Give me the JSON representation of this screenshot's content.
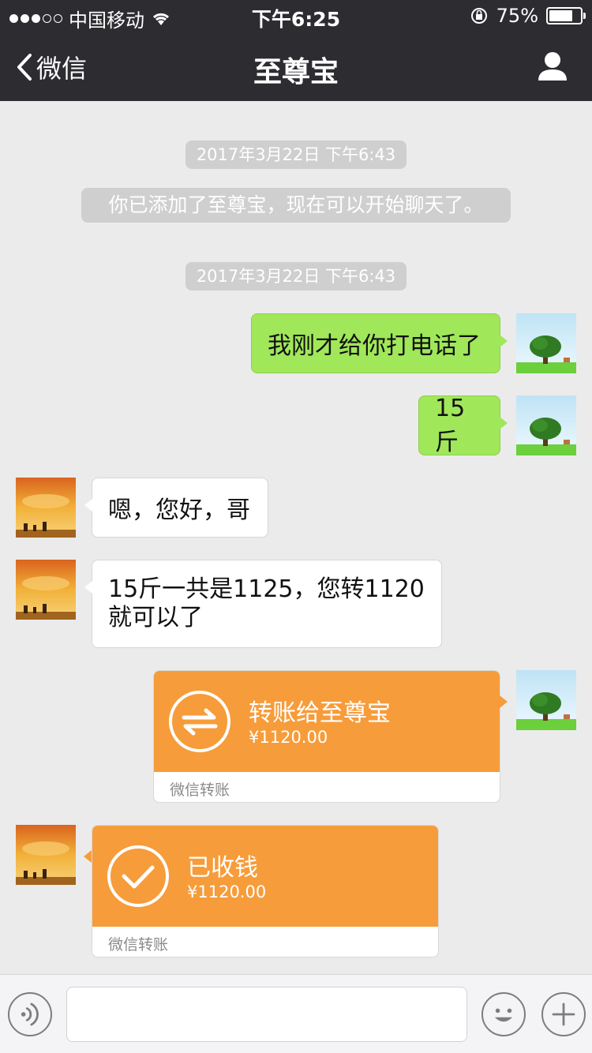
{
  "status_bar": {
    "carrier": "中国移动",
    "time": "下午6:25",
    "battery_percent": "75%",
    "battery_level": 0.75
  },
  "nav": {
    "back_label": "微信",
    "title": "至尊宝"
  },
  "messages": {
    "timestamp_1": "2017年3月22日 下午6:43",
    "system_added": "你已添加了至尊宝，现在可以开始聊天了。",
    "timestamp_2": "2017年3月22日 下午6:43",
    "me_1": "我刚才给你打电话了",
    "me_2": "15斤",
    "them_1": "嗯，您好，哥",
    "them_2": "15斤一共是1125，您转1120就可以了",
    "transfer_sent": {
      "title": "转账给至尊宝",
      "amount": "¥1120.00",
      "footer": "微信转账"
    },
    "transfer_received": {
      "title": "已收钱",
      "amount": "¥1120.00",
      "footer": "微信转账"
    }
  },
  "colors": {
    "topbar": "#2d2c31",
    "my_bubble": "#a0e75a",
    "transfer_orange": "#f79c3a",
    "chat_background": "#ebebeb"
  },
  "icons": [
    "wifi-icon",
    "lock-rotation-icon",
    "battery-icon",
    "back-chevron-icon",
    "profile-icon",
    "transfer-arrows-icon",
    "checkmark-icon",
    "voice-icon",
    "emoji-icon",
    "plus-icon"
  ]
}
